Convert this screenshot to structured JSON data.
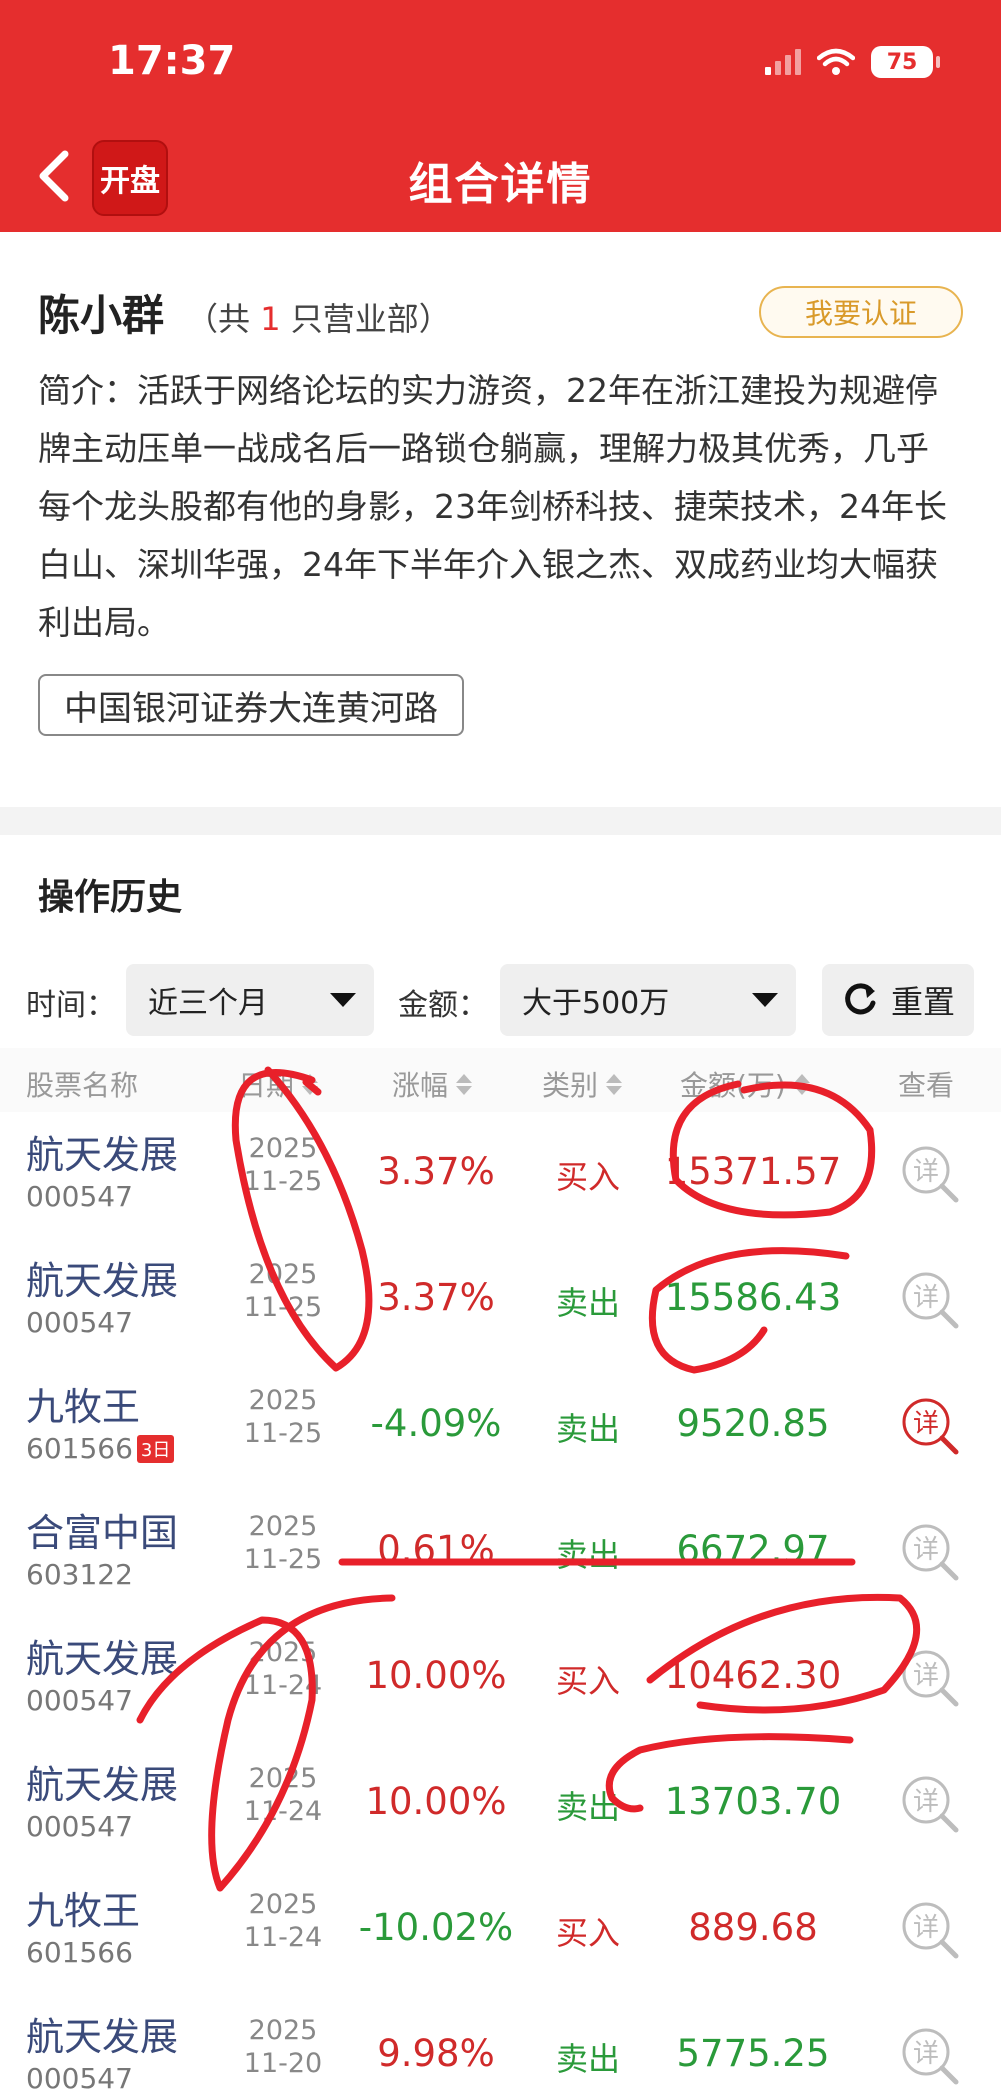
{
  "status_bar": {
    "time": "17:37",
    "battery": "75"
  },
  "header": {
    "title": "组合详情",
    "logo_text": "开盘"
  },
  "profile": {
    "name": "陈小群",
    "branch_count_prefix": "（共",
    "branch_count": "1",
    "branch_count_suffix": "只营业部）",
    "verify_label": "我要认证",
    "intro": "简介：活跃于网络论坛的实力游资，22年在浙江建投为规避停牌主动压单一战成名后一路锁仓躺赢，理解力极其优秀，几乎每个龙头股都有他的身影，23年剑桥科技、捷荣技术，24年长白山、深圳华强，24年下半年介入银之杰、双成药业均大幅获利出局。",
    "branch_tag": "中国银河证券大连黄河路"
  },
  "history": {
    "title": "操作历史",
    "filters": {
      "time_label": "时间：",
      "time_value": "近三个月",
      "amount_label": "金额：",
      "amount_value": "大于500万",
      "reset_label": "重置"
    },
    "columns": [
      "股票名称",
      "日期",
      "涨幅",
      "类别",
      "金额(万)",
      "查看"
    ],
    "rows": [
      {
        "name": "航天发展",
        "code": "000547",
        "badge": "",
        "year": "2025",
        "md": "11-25",
        "pct": "3.37%",
        "pct_dir": "up",
        "type": "买入",
        "type_dir": "up",
        "amount": "15371.57",
        "detail_icon": "detail-magnifier-icon",
        "detail_highlight": false
      },
      {
        "name": "航天发展",
        "code": "000547",
        "badge": "",
        "year": "2025",
        "md": "11-25",
        "pct": "3.37%",
        "pct_dir": "up",
        "type": "卖出",
        "type_dir": "down",
        "amount": "15586.43",
        "detail_icon": "detail-magnifier-icon",
        "detail_highlight": false
      },
      {
        "name": "九牧王",
        "code": "601566",
        "badge": "3日",
        "year": "2025",
        "md": "11-25",
        "pct": "-4.09%",
        "pct_dir": "down",
        "type": "卖出",
        "type_dir": "down",
        "amount": "9520.85",
        "detail_icon": "detail-magnifier-icon",
        "detail_highlight": true
      },
      {
        "name": "合富中国",
        "code": "603122",
        "badge": "",
        "year": "2025",
        "md": "11-25",
        "pct": "0.61%",
        "pct_dir": "up",
        "type": "卖出",
        "type_dir": "down",
        "amount": "6672.97",
        "detail_icon": "detail-magnifier-icon",
        "detail_highlight": false
      },
      {
        "name": "航天发展",
        "code": "000547",
        "badge": "",
        "year": "2025",
        "md": "11-24",
        "pct": "10.00%",
        "pct_dir": "up",
        "type": "买入",
        "type_dir": "up",
        "amount": "10462.30",
        "detail_icon": "detail-magnifier-icon",
        "detail_highlight": false
      },
      {
        "name": "航天发展",
        "code": "000547",
        "badge": "",
        "year": "2025",
        "md": "11-24",
        "pct": "10.00%",
        "pct_dir": "up",
        "type": "卖出",
        "type_dir": "down",
        "amount": "13703.70",
        "detail_icon": "detail-magnifier-icon",
        "detail_highlight": false
      },
      {
        "name": "九牧王",
        "code": "601566",
        "badge": "",
        "year": "2025",
        "md": "11-24",
        "pct": "-10.02%",
        "pct_dir": "down",
        "type": "买入",
        "type_dir": "up",
        "amount": "889.68",
        "detail_icon": "detail-magnifier-icon",
        "detail_highlight": false
      },
      {
        "name": "航天发展",
        "code": "000547",
        "badge": "",
        "year": "2025",
        "md": "11-20",
        "pct": "9.98%",
        "pct_dir": "up",
        "type": "卖出",
        "type_dir": "down",
        "amount": "5775.25",
        "detail_icon": "detail-magnifier-icon",
        "detail_highlight": false
      }
    ]
  },
  "colors": {
    "brand_red": "#e52e2e",
    "rise": "#d02a2a",
    "fall": "#2a9a3a",
    "verify_gold": "#d99a2a",
    "link_blue": "#3a4a7a"
  }
}
